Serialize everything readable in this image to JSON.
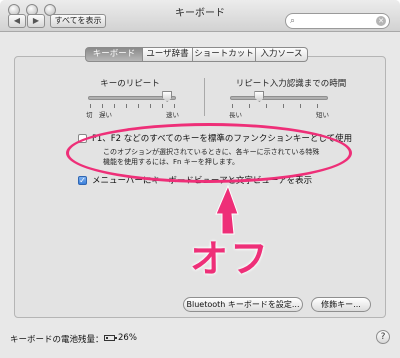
{
  "window": {
    "title": "キーボード"
  },
  "toolbar": {
    "back_icon": "chevron-left-icon",
    "forward_icon": "chevron-right-icon",
    "show_all_label": "すべてを表示",
    "search_placeholder": ""
  },
  "tabs": [
    {
      "label": "キーボード",
      "active": true
    },
    {
      "label": "ユーザ辞書",
      "active": false
    },
    {
      "label": "ショートカット",
      "active": false
    },
    {
      "label": "入力ソース",
      "active": false
    }
  ],
  "key_repeat": {
    "label": "キーのリピート",
    "left_label": "切",
    "left2_label": "遅い",
    "right_label": "速い",
    "value": 0.9
  },
  "delay": {
    "label": "リピート入力認識までの時間",
    "left_label": "長い",
    "right_label": "短い",
    "value": 0.3
  },
  "options": {
    "fn_keys": {
      "label": "F1、F2 などのすべてのキーを標準のファンクションキーとして使用",
      "checked": false,
      "desc_line1": "このオプションが選択されているときに、各キーに示されている特殊",
      "desc_line2": "機能を使用するには、Fn キーを押します。"
    },
    "menu_viewer": {
      "label": "メニューバーにキーボードビューアと文字ビューアを表示",
      "checked": true
    }
  },
  "annotation": {
    "text": "オフ",
    "color": "#ee2f78"
  },
  "buttons": {
    "bluetooth": "Bluetooth キーボードを設定...",
    "modifier": "修飾キー..."
  },
  "footer": {
    "battery_label": "キーボードの電池残量：",
    "battery_percent": "26%",
    "battery_level": 0.26,
    "help": "?"
  }
}
